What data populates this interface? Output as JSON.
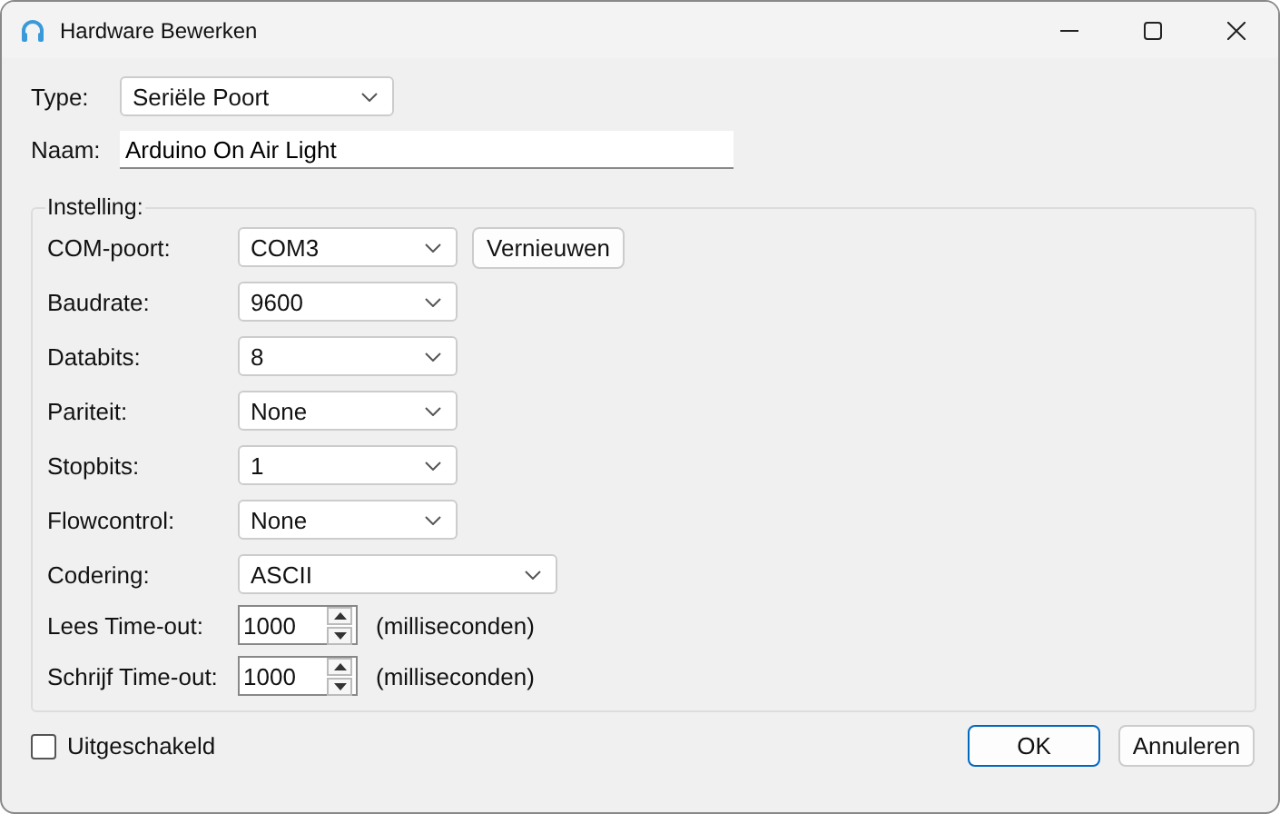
{
  "window": {
    "title": "Hardware Bewerken"
  },
  "type": {
    "label": "Type:",
    "value": "Seriële Poort"
  },
  "name": {
    "label": "Naam:",
    "value": "Arduino On Air Light"
  },
  "settings": {
    "title": "Instelling:",
    "rows": [
      {
        "kind": "combo",
        "label": "COM-poort:",
        "value": "COM3",
        "button": "Vernieuwen"
      },
      {
        "kind": "combo",
        "label": "Baudrate:",
        "value": "9600"
      },
      {
        "kind": "combo",
        "label": "Databits:",
        "value": "8"
      },
      {
        "kind": "combo",
        "label": "Pariteit:",
        "value": "None"
      },
      {
        "kind": "combo",
        "label": "Stopbits:",
        "value": "1"
      },
      {
        "kind": "combo",
        "label": "Flowcontrol:",
        "value": "None"
      },
      {
        "kind": "wide-combo",
        "label": "Codering:",
        "value": "ASCII"
      },
      {
        "kind": "spin",
        "label": "Lees Time-out:",
        "value": "1000",
        "unit": "(milliseconden)"
      },
      {
        "kind": "spin",
        "label": "Schrijf Time-out:",
        "value": "1000",
        "unit": "(milliseconden)"
      }
    ]
  },
  "disabled": {
    "label": "Uitgeschakeld",
    "checked": false
  },
  "buttons": [
    {
      "label": "OK",
      "default": true
    },
    {
      "label": "Annuleren",
      "default": false
    }
  ]
}
